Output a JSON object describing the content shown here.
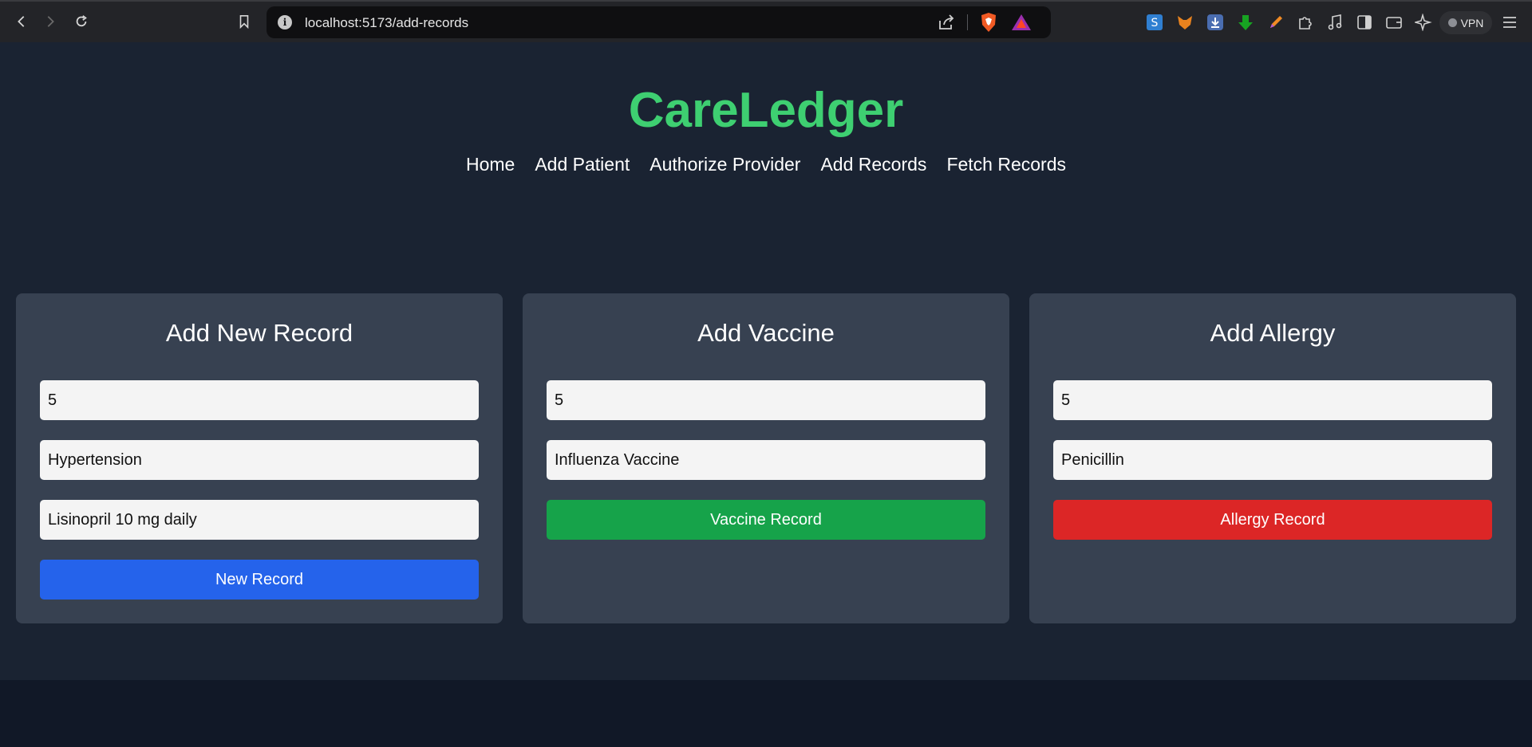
{
  "browser": {
    "url": "localhost:5173/add-records",
    "vpn_label": "VPN",
    "extensions": [
      "s-icon",
      "fox-icon",
      "download-badge-icon",
      "green-arrow-icon",
      "pen-icon",
      "puzzle-icon",
      "music-icon",
      "sidebar-icon",
      "wallet-icon",
      "sparkle-icon",
      "menu-icon"
    ]
  },
  "header": {
    "brand": "CareLedger",
    "nav": [
      "Home",
      "Add Patient",
      "Authorize Provider",
      "Add Records",
      "Fetch Records"
    ]
  },
  "cards": {
    "record": {
      "title": "Add New Record",
      "patient_id": "5",
      "diagnosis": "Hypertension",
      "treatment": "Lisinopril 10 mg daily",
      "button": "New Record"
    },
    "vaccine": {
      "title": "Add Vaccine",
      "patient_id": "5",
      "vaccine": "Influenza Vaccine",
      "button": "Vaccine Record"
    },
    "allergy": {
      "title": "Add Allergy",
      "patient_id": "5",
      "allergy": "Penicillin",
      "button": "Allergy Record"
    }
  },
  "colors": {
    "brand": "#3ecf71",
    "blue": "#2563eb",
    "green": "#16a34a",
    "red": "#dc2626"
  }
}
